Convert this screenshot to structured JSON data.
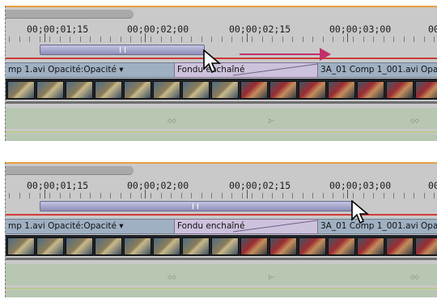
{
  "timecodes": [
    "00;00;01;15",
    "00;00;02;00",
    "00;00;02;15",
    "00;00;03;00",
    "00"
  ],
  "top_panel": {
    "clip_a": "mp 1.avi Opacité:Opacité ▾",
    "transition": "Fondu enchaîné",
    "clip_b": "3A_01 Comp 1_001.avi Opac"
  },
  "bottom_panel": {
    "clip_a": "mp 1.avi Opacité:Opacité ▾",
    "transition": "Fondu enchaîné",
    "clip_b": "3A_01 Comp 1_001.avi Opac"
  },
  "icons": {
    "cursor": "arrow-cursor-icon",
    "drag_arrow": "right-arrow-icon"
  },
  "colors": {
    "arrow": "#c0306a",
    "red_line": "#d23a3a",
    "work_bar": "#9b9bc8"
  }
}
